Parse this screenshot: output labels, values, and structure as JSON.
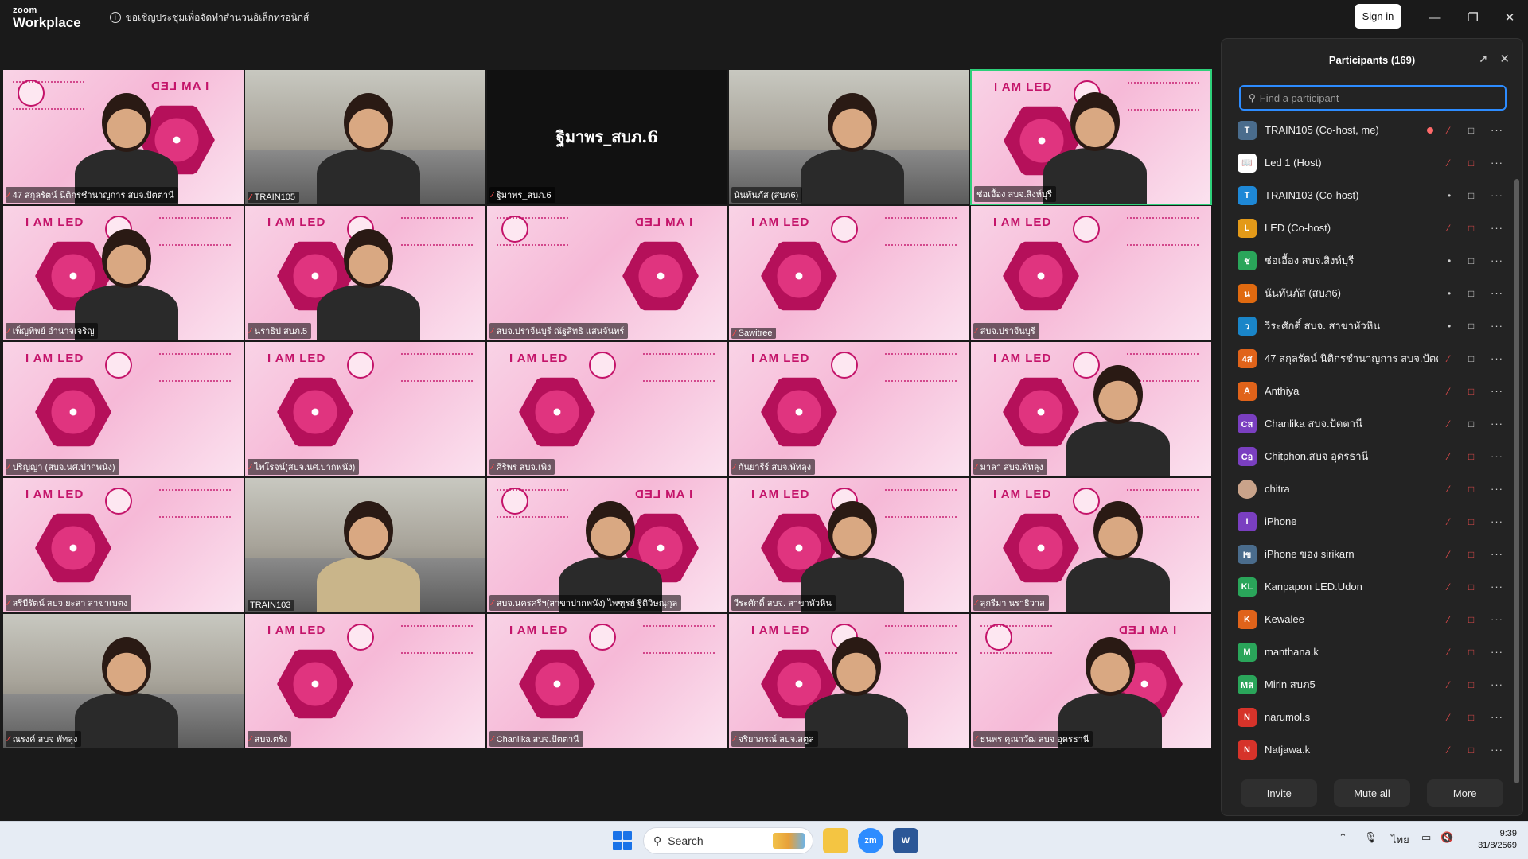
{
  "titlebar": {
    "brand_top": "zoom",
    "brand_bottom": "Workplace",
    "meeting_topic": "ขอเชิญประชุมเพื่อจัดทำสำนวนอิเล็กทรอนิกส์",
    "signin_label": "Sign in"
  },
  "tiles": [
    {
      "name": "47 สกุลรัตน์ นิติกรชำนาญการ สบจ.ปัตตานี",
      "muted": true
    },
    {
      "name": "TRAIN105",
      "muted": true
    },
    {
      "name": "ฐิมาพร_สบภ.6",
      "muted": true,
      "center": "ฐิมาพร_สบภ.6"
    },
    {
      "name": "นันทันภัส (สบภ6)",
      "muted": false
    },
    {
      "name": "ช่อเอื้อง สบจ.สิงห์บุรี",
      "muted": false
    },
    {
      "name": "เพ็ญทิพย์ อำนาจเจริญ",
      "muted": true
    },
    {
      "name": "นราธิป สบภ.5",
      "muted": true
    },
    {
      "name": "สบจ.ปราจีนบุรี ณัฐสิทธิ แสนจันทร์",
      "muted": true
    },
    {
      "name": "Sawitree",
      "muted": true
    },
    {
      "name": "สบจ.ปราจีนบุรี",
      "muted": true
    },
    {
      "name": "ปริญญา (สบจ.นศ.ปากพนัง)",
      "muted": true
    },
    {
      "name": "ไพโรจน์(สบจ.นศ.ปากพนัง)",
      "muted": true
    },
    {
      "name": "ศิริพร สบจ.เพิง",
      "muted": true
    },
    {
      "name": "กันยารีร์ สบจ.พัทลุง",
      "muted": true
    },
    {
      "name": "มาลา สบจ.พัทลุง",
      "muted": true
    },
    {
      "name": "สรีบีรัตน์ สบจ.ยะลา สาขาเบตง",
      "muted": true
    },
    {
      "name": "TRAIN103",
      "muted": false
    },
    {
      "name": "สบจ.นครศรีฯ(สาขาปากพนัง) ไพฑูรย์ ฐิติวิษณุกุล",
      "muted": true
    },
    {
      "name": "วีระศักดิ์ สบจ. สาขาหัวหิน",
      "muted": false
    },
    {
      "name": "สุกรีมา นราธิวาส",
      "muted": true
    },
    {
      "name": "ณรงค์ สบจ พัทลุง",
      "muted": true
    },
    {
      "name": "สบจ.ตรัง",
      "muted": true
    },
    {
      "name": "Chanlika สบจ.ปัตตานี",
      "muted": true
    },
    {
      "name": "จริยาภรณ์ สบจ.สตูล",
      "muted": true
    },
    {
      "name": "ธนพร คุณาวัฒ สบจ อุดรธานี",
      "muted": true
    }
  ],
  "banner": {
    "text": "I AM LED",
    "flipped": "ΙΑΜ LED"
  },
  "panel": {
    "title": "Participants (169)",
    "search_placeholder": "Find a participant",
    "invite": "Invite",
    "mute_all": "Mute all",
    "more": "More"
  },
  "participants": [
    {
      "name": "TRAIN105 (Co-host, me)",
      "avatar": "T",
      "color": "#4a6c8c",
      "mic": "off",
      "cam": "on",
      "rec": true
    },
    {
      "name": "Led 1 (Host)",
      "avatar": "📖",
      "color": "#ffffff",
      "mic": "off",
      "cam": "off"
    },
    {
      "name": "TRAIN103 (Co-host)",
      "avatar": "T",
      "color": "#1e88d6",
      "mic": "on",
      "cam": "on"
    },
    {
      "name": "LED (Co-host)",
      "avatar": "L",
      "color": "#e39a19",
      "mic": "off",
      "cam": "off"
    },
    {
      "name": "ช่อเอื้อง สบจ.สิงห์บุรี",
      "avatar": "ช",
      "color": "#2aa55a",
      "mic": "on",
      "cam": "on"
    },
    {
      "name": "นันทันภัส (สบภ6)",
      "avatar": "น",
      "color": "#e06a10",
      "mic": "on",
      "cam": "on"
    },
    {
      "name": "วีระศักดิ์ สบจ. สาขาหัวหิน",
      "avatar": "ว",
      "color": "#1a85c8",
      "mic": "on",
      "cam": "on"
    },
    {
      "name": "47 สกุลรัตน์ นิติกรชำนาญการ สบจ.ปัตตานี",
      "avatar": "4ส",
      "color": "#e0631a",
      "mic": "off",
      "cam": "on"
    },
    {
      "name": "Anthiya",
      "avatar": "A",
      "color": "#e0631a",
      "mic": "off",
      "cam": "off"
    },
    {
      "name": "Chanlika สบจ.ปัตตานี",
      "avatar": "Cส",
      "color": "#7a3fc0",
      "mic": "off",
      "cam": "on"
    },
    {
      "name": "Chitphon.สบจ อุดรธานี",
      "avatar": "Cอ",
      "color": "#7a3fc0",
      "mic": "off",
      "cam": "off"
    },
    {
      "name": "chitra",
      "avatar": "",
      "color": "#c9a38a",
      "mic": "off",
      "cam": "off"
    },
    {
      "name": "iPhone",
      "avatar": "I",
      "color": "#7a3fc0",
      "mic": "off",
      "cam": "off"
    },
    {
      "name": "iPhone ของ sirikarn",
      "avatar": "Iข",
      "color": "#4a6c8c",
      "mic": "off",
      "cam": "off"
    },
    {
      "name": "Kanpapon LED.Udon",
      "avatar": "KL",
      "color": "#2aa55a",
      "mic": "off",
      "cam": "off"
    },
    {
      "name": "Kewalee",
      "avatar": "K",
      "color": "#e0631a",
      "mic": "off",
      "cam": "off"
    },
    {
      "name": "manthana.k",
      "avatar": "M",
      "color": "#2aa55a",
      "mic": "off",
      "cam": "off"
    },
    {
      "name": "Mirin สบภ5",
      "avatar": "Mส",
      "color": "#2aa55a",
      "mic": "off",
      "cam": "off"
    },
    {
      "name": "narumol.s",
      "avatar": "N",
      "color": "#d6332a",
      "mic": "off",
      "cam": "off"
    },
    {
      "name": "Natjawa.k",
      "avatar": "N",
      "color": "#d6332a",
      "mic": "off",
      "cam": "off"
    }
  ],
  "taskbar": {
    "search_label": "Search",
    "ime": "ไทย",
    "time": "9:39",
    "date": "31/8/2569"
  },
  "colors": {
    "accent": "#2d8cff",
    "muted_red": "#e24b4b",
    "active_speaker": "#2ecf7a",
    "banner_pink": "#c4146a"
  }
}
